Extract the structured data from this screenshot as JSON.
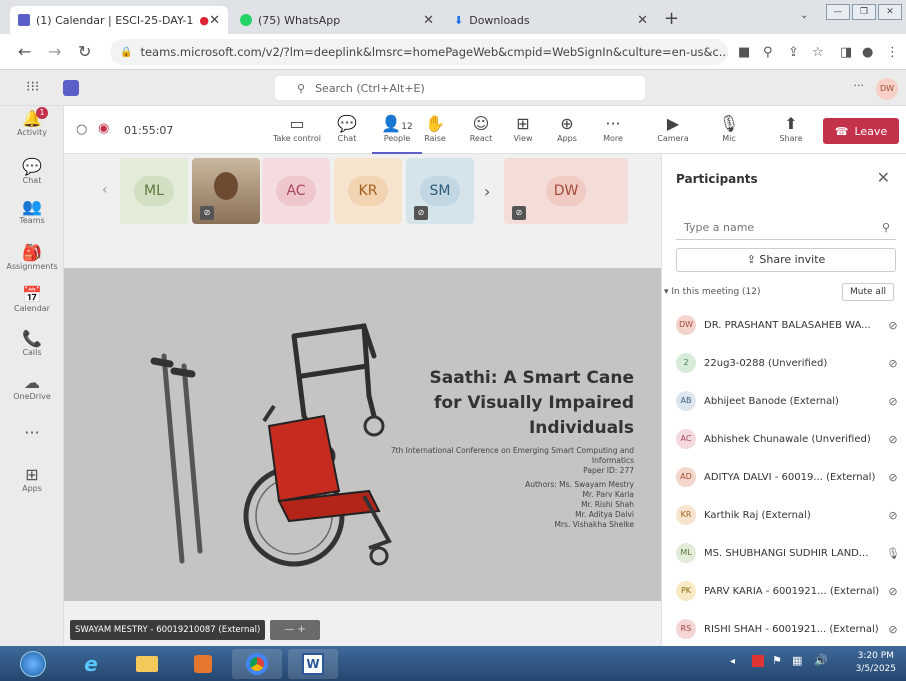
{
  "browser": {
    "tabs": [
      {
        "title": "(1) Calendar | ESCI-25-DAY-1",
        "favicon_color": "#5b5fc7"
      },
      {
        "title": "(75) WhatsApp",
        "favicon_color": "#25d366"
      },
      {
        "title": "Downloads",
        "favicon_color": "#1a73e8"
      }
    ],
    "new_tab": "+",
    "url": "teams.microsoft.com/v2/?lm=deeplink&lmsrc=homePageWeb&cmpid=WebSignIn&culture=en-us&c..."
  },
  "teams": {
    "search_placeholder": "Search (Ctrl+Alt+E)",
    "user_initials": "DW",
    "more": "···"
  },
  "rail": [
    {
      "label": "Activity",
      "icon": "bell-icon",
      "glyph": "🔔",
      "badge": "1"
    },
    {
      "label": "Chat",
      "icon": "chat-icon",
      "glyph": "💬"
    },
    {
      "label": "Teams",
      "icon": "teams-icon",
      "glyph": "👥"
    },
    {
      "label": "Assignments",
      "icon": "assignments-icon",
      "glyph": "🎒"
    },
    {
      "label": "Calendar",
      "icon": "calendar-icon",
      "glyph": "📅"
    },
    {
      "label": "Calls",
      "icon": "phone-icon",
      "glyph": "📞"
    },
    {
      "label": "OneDrive",
      "icon": "cloud-icon",
      "glyph": "☁"
    },
    {
      "label": "",
      "icon": "more-icon",
      "glyph": "···"
    },
    {
      "label": "Apps",
      "icon": "apps-icon",
      "glyph": "⊞"
    }
  ],
  "meeting": {
    "timer": "01:55:07",
    "tools": [
      {
        "label": "Take control",
        "icon": "take-control-icon",
        "glyph": "▭"
      },
      {
        "label": "Chat",
        "icon": "chat-icon",
        "glyph": "💬"
      },
      {
        "label": "People",
        "icon": "people-icon",
        "glyph": "👤",
        "count": "12"
      },
      {
        "label": "Raise",
        "icon": "raise-hand-icon",
        "glyph": "✋"
      },
      {
        "label": "React",
        "icon": "react-icon",
        "glyph": "☺"
      },
      {
        "label": "View",
        "icon": "view-icon",
        "glyph": "⊞"
      },
      {
        "label": "Apps",
        "icon": "apps-icon",
        "glyph": "⊕"
      },
      {
        "label": "More",
        "icon": "more-icon",
        "glyph": "···"
      },
      {
        "label": "Camera",
        "icon": "camera-off-icon",
        "glyph": "▶"
      },
      {
        "label": "Mic",
        "icon": "mic-off-icon",
        "glyph": "🎙"
      },
      {
        "label": "Share",
        "icon": "share-icon",
        "glyph": "⬆"
      }
    ],
    "leave_label": "Leave"
  },
  "gallery": [
    {
      "initials": "ML",
      "bg": "#e3ebd9",
      "circle": "#d2dfc2",
      "color": "#5a7a3a"
    },
    {
      "initials": "",
      "video": true
    },
    {
      "initials": "AC",
      "bg": "#f4dce0",
      "circle": "#f0c6cd",
      "color": "#a7455b"
    },
    {
      "initials": "KR",
      "bg": "#f6e4cf",
      "circle": "#f3d4b2",
      "color": "#a45f1a"
    },
    {
      "initials": "SM",
      "bg": "#d5e3ea",
      "circle": "#c2d7e2",
      "color": "#2c5e78"
    },
    {
      "initials": "DW",
      "bg": "#f4ddd9",
      "circle": "#f0cac3",
      "color": "#a24c3a"
    }
  ],
  "slide": {
    "title_lines": [
      "Saathi: A Smart Cane",
      "for Visually Impaired",
      "Individuals"
    ],
    "conference": [
      "7th International Conference on Emerging Smart Computing and",
      "Informatics",
      "Paper ID: 277"
    ],
    "authors": [
      "Authors: Ms. Swayam Mestry",
      "Mr. Parv Karia",
      "Mr. Rishi Shah",
      "Mr. Aditya Dalvi",
      "Mrs. Vishakha Shelke"
    ]
  },
  "presenter_label": "SWAYAM MESTRY - 60019210087 (External)",
  "panel": {
    "title": "Participants",
    "search_placeholder": "Type a name",
    "share_invite": "Share invite",
    "in_meeting": "In this meeting (12)",
    "mute_all": "Mute all",
    "people": [
      {
        "initials": "DW",
        "name": "DR. PRASHANT BALASAHEB WA...",
        "bg": "#f4d4cd",
        "fg": "#a24c3a",
        "mic": "mic-off"
      },
      {
        "initials": "2",
        "name": "22ug3-0288 (Unverified)",
        "bg": "#d6ecd9",
        "fg": "#3b7d48",
        "mic": "mic-off"
      },
      {
        "initials": "AB",
        "name": "Abhijeet Banode (External)",
        "bg": "#dde6ee",
        "fg": "#3d5f7f",
        "mic": "mic-off"
      },
      {
        "initials": "AC",
        "name": "Abhishek Chunawale (Unverified)",
        "bg": "#f4d9de",
        "fg": "#a7455b",
        "mic": "mic-off"
      },
      {
        "initials": "AD",
        "name": "ADITYA DALVI - 60019...  (External)",
        "bg": "#f4d6cc",
        "fg": "#a4502f",
        "mic": "mic-off"
      },
      {
        "initials": "KR",
        "name": "Karthik Raj (External)",
        "bg": "#f6e4cf",
        "fg": "#a45f1a",
        "mic": "mic-off"
      },
      {
        "initials": "ML",
        "name": "MS. SHUBHANGI SUDHIR LAND...",
        "bg": "#e3ebd9",
        "fg": "#5a7a3a",
        "mic": "mic-on"
      },
      {
        "initials": "PK",
        "name": "PARV KARIA - 6001921...  (External)",
        "bg": "#f7eac4",
        "fg": "#8c6a12",
        "mic": "mic-off"
      },
      {
        "initials": "RS",
        "name": "RISHI SHAH - 6001921...  (External)",
        "bg": "#f4d6d6",
        "fg": "#a43c3c",
        "mic": "mic-off"
      }
    ]
  },
  "taskbar": {
    "apps": [
      "start-button",
      "internet-explorer-icon",
      "file-explorer-icon",
      "media-player-icon",
      "chrome-icon",
      "word-icon"
    ],
    "time": "3:20 PM",
    "date": "3/5/2025"
  }
}
